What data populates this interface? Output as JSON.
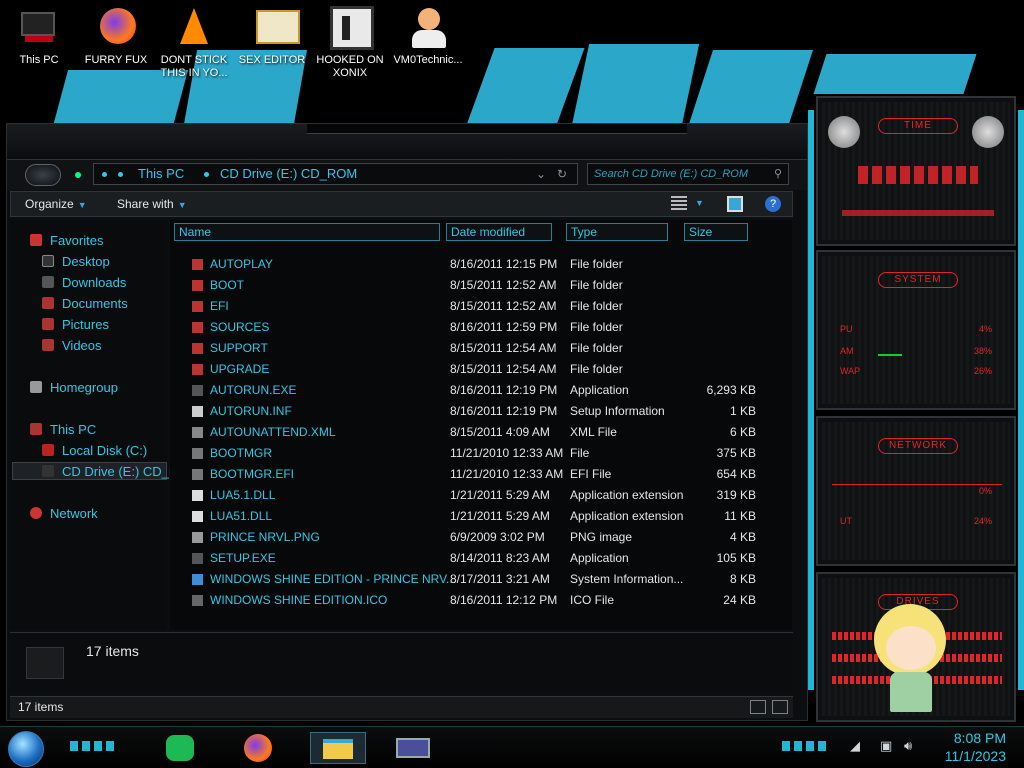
{
  "desktop_icons": [
    {
      "label": "This PC",
      "icon": "computer-icon"
    },
    {
      "label": "FURRY FUX",
      "icon": "firefox-icon"
    },
    {
      "label": "DONT STICK THIS IN YO...",
      "icon": "vlc-cone-icon"
    },
    {
      "label": "SEX EDITOR",
      "icon": "hex-editor-icon"
    },
    {
      "label": "HOOKED ON XONIX",
      "icon": "xonix-game-icon"
    },
    {
      "label": "VM0Technic...",
      "icon": "doctor-avatar-icon"
    }
  ],
  "explorer": {
    "address": [
      "This PC",
      "CD Drive (E:) CD_ROM"
    ],
    "search_placeholder": "Search CD Drive (E:) CD_ROM",
    "toolbar": {
      "organize": "Organize",
      "share_with": "Share with"
    },
    "nav": {
      "favorites": "Favorites",
      "desktop": "Desktop",
      "downloads": "Downloads",
      "documents": "Documents",
      "pictures": "Pictures",
      "videos": "Videos",
      "homegroup": "Homegroup",
      "this_pc": "This PC",
      "local_disk": "Local Disk (C:)",
      "cd_drive": "CD Drive (E:) CD_R",
      "network": "Network"
    },
    "columns": {
      "name": "Name",
      "date": "Date modified",
      "type": "Type",
      "size": "Size"
    },
    "files": [
      {
        "name": "AUTOPLAY",
        "date": "8/16/2011 12:15 PM",
        "type": "File folder",
        "size": "",
        "icon": "folder-icon"
      },
      {
        "name": "BOOT",
        "date": "8/15/2011 12:52 AM",
        "type": "File folder",
        "size": "",
        "icon": "folder-icon"
      },
      {
        "name": "EFI",
        "date": "8/15/2011 12:52 AM",
        "type": "File folder",
        "size": "",
        "icon": "folder-icon"
      },
      {
        "name": "SOURCES",
        "date": "8/16/2011 12:59 PM",
        "type": "File folder",
        "size": "",
        "icon": "folder-icon"
      },
      {
        "name": "SUPPORT",
        "date": "8/15/2011 12:54 AM",
        "type": "File folder",
        "size": "",
        "icon": "folder-icon"
      },
      {
        "name": "UPGRADE",
        "date": "8/15/2011 12:54 AM",
        "type": "File folder",
        "size": "",
        "icon": "folder-icon"
      },
      {
        "name": "AUTORUN.EXE",
        "date": "8/16/2011 12:19 PM",
        "type": "Application",
        "size": "6,293 KB",
        "icon": "application-icon"
      },
      {
        "name": "AUTORUN.INF",
        "date": "8/16/2011 12:19 PM",
        "type": "Setup Information",
        "size": "1 KB",
        "icon": "settings-file-icon"
      },
      {
        "name": "AUTOUNATTEND.XML",
        "date": "8/15/2011 4:09 AM",
        "type": "XML File",
        "size": "6 KB",
        "icon": "xml-file-icon"
      },
      {
        "name": "BOOTMGR",
        "date": "11/21/2010 12:33 AM",
        "type": "File",
        "size": "375 KB",
        "icon": "file-icon"
      },
      {
        "name": "BOOTMGR.EFI",
        "date": "11/21/2010 12:33 AM",
        "type": "EFI File",
        "size": "654 KB",
        "icon": "file-icon"
      },
      {
        "name": "LUA5.1.DLL",
        "date": "1/21/2011 5:29 AM",
        "type": "Application extension",
        "size": "319 KB",
        "icon": "dll-icon"
      },
      {
        "name": "LUA51.DLL",
        "date": "1/21/2011 5:29 AM",
        "type": "Application extension",
        "size": "11 KB",
        "icon": "dll-icon"
      },
      {
        "name": "PRINCE NRVL.PNG",
        "date": "6/9/2009 3:02 PM",
        "type": "PNG image",
        "size": "4 KB",
        "icon": "image-file-icon"
      },
      {
        "name": "SETUP.EXE",
        "date": "8/14/2011 8:23 AM",
        "type": "Application",
        "size": "105 KB",
        "icon": "application-icon"
      },
      {
        "name": "WINDOWS SHINE EDITION - PRINCE NRV...",
        "date": "8/17/2011 3:21 AM",
        "type": "System Information...",
        "size": "8 KB",
        "icon": "system-info-icon"
      },
      {
        "name": "WINDOWS SHINE EDITION.ICO",
        "date": "8/16/2011 12:12 PM",
        "type": "ICO File",
        "size": "24 KB",
        "icon": "ico-file-icon"
      }
    ],
    "details_count": "17 items",
    "status_count": "17 items"
  },
  "gadgets": {
    "time": {
      "title": "TIME"
    },
    "system": {
      "title": "SYSTEM",
      "rows": [
        {
          "label": "PU",
          "value": "4%"
        },
        {
          "label": "AM",
          "value": "38%"
        },
        {
          "label": "WAP",
          "value": "26%"
        }
      ]
    },
    "network": {
      "title": "NETWORK",
      "rows": [
        {
          "label": "",
          "value": "0%"
        },
        {
          "label": "UT",
          "value": "24%"
        }
      ]
    },
    "drives": {
      "title": "DRIVES"
    }
  },
  "taskbar": {
    "apps": [
      "notes-app-icon",
      "firefox-icon",
      "file-explorer-icon",
      "control-panel-icon"
    ],
    "time": "8:08 PM",
    "date": "11/1/2023"
  },
  "colors": {
    "accent": "#31c8e6",
    "alien_red": "#e0252a",
    "window_bg": "#0c0d0f"
  }
}
